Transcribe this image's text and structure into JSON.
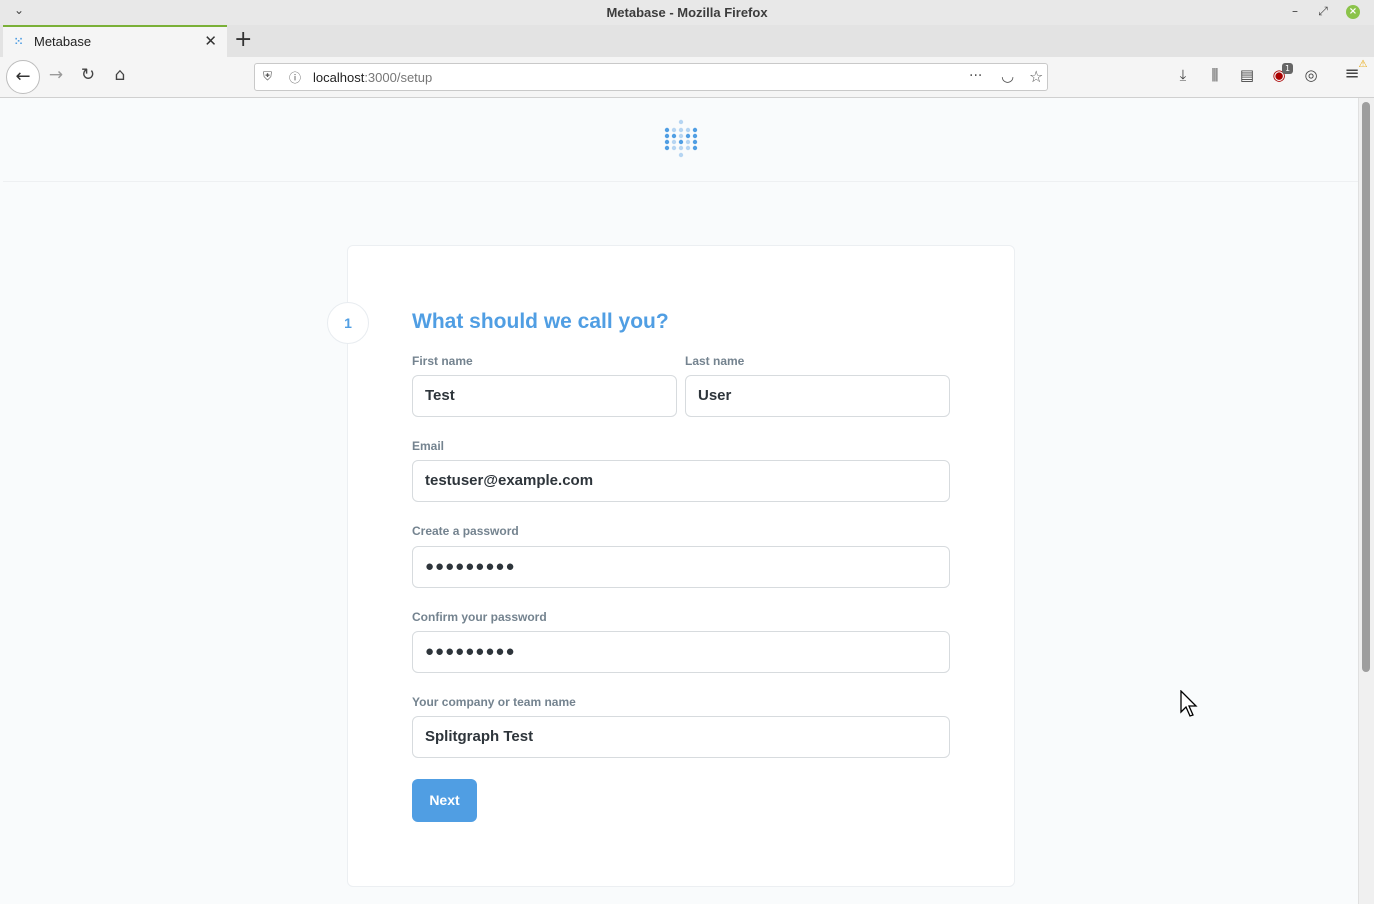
{
  "window": {
    "title": "Metabase - Mozilla Firefox",
    "menu_glyph": "⌄",
    "minimize_glyph": "–",
    "maximize_glyph": "⤢",
    "close_glyph": "×"
  },
  "tab": {
    "title": "Metabase",
    "favicon": "metabase-icon",
    "close_glyph": "✕",
    "new_tab_glyph": "+"
  },
  "nav": {
    "back_glyph": "←",
    "forward_glyph": "→",
    "reload_glyph": "↻",
    "home_glyph": "⌂",
    "url_host": "localhost",
    "url_rest": ":3000/setup",
    "shield_glyph": "⛨",
    "info_glyph": "ⓘ",
    "more_glyph": "···",
    "pocket_glyph": "◡",
    "star_glyph": "☆"
  },
  "toolbar": {
    "downloads_glyph": "⤓",
    "library_glyph": "⫼",
    "sidebar_glyph": "▤",
    "ublock_glyph": "◉",
    "ublock_badge": "1",
    "account_glyph": "◎",
    "menu_glyph": "≡",
    "warning_glyph": "⚠"
  },
  "setup": {
    "step_number": "1",
    "heading": "What should we call you?",
    "first_name": {
      "label": "First name",
      "value": "Test"
    },
    "last_name": {
      "label": "Last name",
      "value": "User"
    },
    "email": {
      "label": "Email",
      "value": "testuser@example.com"
    },
    "password": {
      "label": "Create a password",
      "value": "●●●●●●●●●"
    },
    "confirm_password": {
      "label": "Confirm your password",
      "value": "●●●●●●●●●"
    },
    "company": {
      "label": "Your company or team name",
      "value": "Splitgraph Test"
    },
    "next_label": "Next"
  },
  "colors": {
    "brand": "#509ee3",
    "label": "#74838f",
    "text": "#2e353b",
    "tab_accent": "#7ab037"
  }
}
